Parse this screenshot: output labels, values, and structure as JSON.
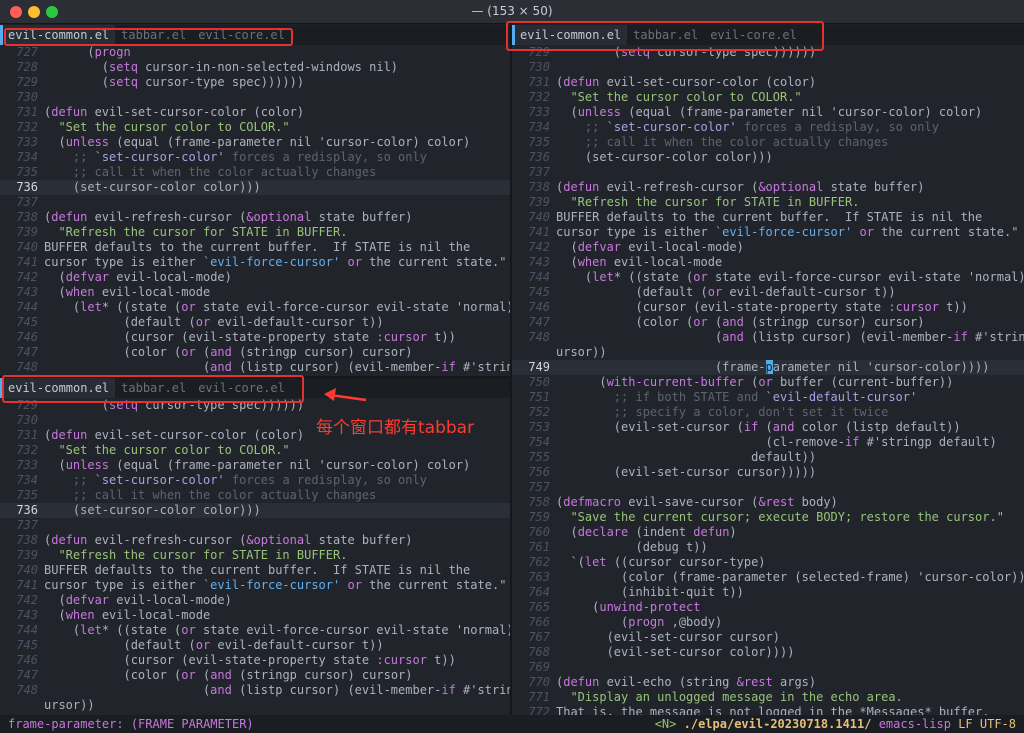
{
  "window": {
    "title": "— (153 × 50)",
    "buttons": [
      {
        "name": "close",
        "color": "#fe5f57"
      },
      {
        "name": "minimize",
        "color": "#febc2e"
      },
      {
        "name": "zoom",
        "color": "#28c840"
      }
    ]
  },
  "tabs": [
    "evil-common.el",
    "tabbar.el",
    "evil-core.el"
  ],
  "panes": {
    "top_left": {
      "lines": [
        {
          "n": "727",
          "c": "      (progn"
        },
        {
          "n": "728",
          "c": "        (setq cursor-in-non-selected-windows nil)"
        },
        {
          "n": "729",
          "c": "        (setq cursor-type spec))))))"
        },
        {
          "n": "730",
          "c": ""
        },
        {
          "n": "731",
          "c": "(defun evil-set-cursor-color (color)"
        },
        {
          "n": "732",
          "c": "  \"Set the cursor color to COLOR.\""
        },
        {
          "n": "733",
          "c": "  (unless (equal (frame-parameter nil 'cursor-color) color)"
        },
        {
          "n": "734",
          "c": "    ;; `set-cursor-color' forces a redisplay, so only"
        },
        {
          "n": "735",
          "c": "    ;; call it when the color actually changes"
        },
        {
          "n": "736",
          "c": "    (set-cursor-color color)))",
          "cur": true
        },
        {
          "n": "737",
          "c": ""
        },
        {
          "n": "738",
          "c": "(defun evil-refresh-cursor (&optional state buffer)"
        },
        {
          "n": "739",
          "c": "  \"Refresh the cursor for STATE in BUFFER."
        },
        {
          "n": "740",
          "c": "BUFFER defaults to the current buffer.  If STATE is nil the"
        },
        {
          "n": "741",
          "c": "cursor type is either `evil-force-cursor' or the current state.\""
        },
        {
          "n": "742",
          "c": "  (defvar evil-local-mode)"
        },
        {
          "n": "743",
          "c": "  (when evil-local-mode"
        },
        {
          "n": "744",
          "c": "    (let* ((state (or state evil-force-cursor evil-state 'normal))"
        },
        {
          "n": "745",
          "c": "           (default (or evil-default-cursor t))"
        },
        {
          "n": "746",
          "c": "           (cursor (evil-state-property state :cursor t))"
        },
        {
          "n": "747",
          "c": "           (color (or (and (stringp cursor) cursor)"
        },
        {
          "n": "748",
          "c": "                      (and (listp cursor) (evil-member-if #'stringp c"
        }
      ]
    },
    "bottom_left": {
      "lines": [
        {
          "n": "729",
          "c": "        (setq cursor-type spec))))))"
        },
        {
          "n": "730",
          "c": ""
        },
        {
          "n": "731",
          "c": "(defun evil-set-cursor-color (color)"
        },
        {
          "n": "732",
          "c": "  \"Set the cursor color to COLOR.\""
        },
        {
          "n": "733",
          "c": "  (unless (equal (frame-parameter nil 'cursor-color) color)"
        },
        {
          "n": "734",
          "c": "    ;; `set-cursor-color' forces a redisplay, so only"
        },
        {
          "n": "735",
          "c": "    ;; call it when the color actually changes"
        },
        {
          "n": "736",
          "c": "    (set-cursor-color color)))",
          "cur": true
        },
        {
          "n": "737",
          "c": ""
        },
        {
          "n": "738",
          "c": "(defun evil-refresh-cursor (&optional state buffer)"
        },
        {
          "n": "739",
          "c": "  \"Refresh the cursor for STATE in BUFFER."
        },
        {
          "n": "740",
          "c": "BUFFER defaults to the current buffer.  If STATE is nil the"
        },
        {
          "n": "741",
          "c": "cursor type is either `evil-force-cursor' or the current state.\""
        },
        {
          "n": "742",
          "c": "  (defvar evil-local-mode)"
        },
        {
          "n": "743",
          "c": "  (when evil-local-mode"
        },
        {
          "n": "744",
          "c": "    (let* ((state (or state evil-force-cursor evil-state 'normal))"
        },
        {
          "n": "745",
          "c": "           (default (or evil-default-cursor t))"
        },
        {
          "n": "746",
          "c": "           (cursor (evil-state-property state :cursor t))"
        },
        {
          "n": "747",
          "c": "           (color (or (and (stringp cursor) cursor)"
        },
        {
          "n": "748",
          "c": "                      (and (listp cursor) (evil-member-if #'stringp c"
        },
        {
          "n": "",
          "c": "ursor))"
        }
      ]
    },
    "right": {
      "lines": [
        {
          "n": "729",
          "c": "        (setq cursor-type spec))))))"
        },
        {
          "n": "730",
          "c": ""
        },
        {
          "n": "731",
          "c": "(defun evil-set-cursor-color (color)"
        },
        {
          "n": "732",
          "c": "  \"Set the cursor color to COLOR.\""
        },
        {
          "n": "733",
          "c": "  (unless (equal (frame-parameter nil 'cursor-color) color)"
        },
        {
          "n": "734",
          "c": "    ;; `set-cursor-color' forces a redisplay, so only"
        },
        {
          "n": "735",
          "c": "    ;; call it when the color actually changes"
        },
        {
          "n": "736",
          "c": "    (set-cursor-color color)))"
        },
        {
          "n": "737",
          "c": ""
        },
        {
          "n": "738",
          "c": "(defun evil-refresh-cursor (&optional state buffer)"
        },
        {
          "n": "739",
          "c": "  \"Refresh the cursor for STATE in BUFFER."
        },
        {
          "n": "740",
          "c": "BUFFER defaults to the current buffer.  If STATE is nil the"
        },
        {
          "n": "741",
          "c": "cursor type is either `evil-force-cursor' or the current state.\""
        },
        {
          "n": "742",
          "c": "  (defvar evil-local-mode)"
        },
        {
          "n": "743",
          "c": "  (when evil-local-mode"
        },
        {
          "n": "744",
          "c": "    (let* ((state (or state evil-force-cursor evil-state 'normal))"
        },
        {
          "n": "745",
          "c": "           (default (or evil-default-cursor t))"
        },
        {
          "n": "746",
          "c": "           (cursor (evil-state-property state :cursor t))"
        },
        {
          "n": "747",
          "c": "           (color (or (and (stringp cursor) cursor)"
        },
        {
          "n": "748",
          "c": "                      (and (listp cursor) (evil-member-if #'stringp c"
        },
        {
          "n": "",
          "c": "ursor))"
        },
        {
          "n": "749",
          "c": "                      (frame-parameter nil 'cursor-color))))",
          "cur": true
        },
        {
          "n": "750",
          "c": "      (with-current-buffer (or buffer (current-buffer))"
        },
        {
          "n": "751",
          "c": "        ;; if both STATE and `evil-default-cursor'"
        },
        {
          "n": "752",
          "c": "        ;; specify a color, don't set it twice"
        },
        {
          "n": "753",
          "c": "        (evil-set-cursor (if (and color (listp default))"
        },
        {
          "n": "754",
          "c": "                             (cl-remove-if #'stringp default)"
        },
        {
          "n": "755",
          "c": "                           default))"
        },
        {
          "n": "756",
          "c": "        (evil-set-cursor cursor)))))"
        },
        {
          "n": "757",
          "c": ""
        },
        {
          "n": "758",
          "c": "(defmacro evil-save-cursor (&rest body)"
        },
        {
          "n": "759",
          "c": "  \"Save the current cursor; execute BODY; restore the cursor.\""
        },
        {
          "n": "760",
          "c": "  (declare (indent defun)"
        },
        {
          "n": "761",
          "c": "           (debug t))"
        },
        {
          "n": "762",
          "c": "  `(let ((cursor cursor-type)"
        },
        {
          "n": "763",
          "c": "         (color (frame-parameter (selected-frame) 'cursor-color))"
        },
        {
          "n": "764",
          "c": "         (inhibit-quit t))"
        },
        {
          "n": "765",
          "c": "     (unwind-protect"
        },
        {
          "n": "766",
          "c": "         (progn ,@body)"
        },
        {
          "n": "767",
          "c": "       (evil-set-cursor cursor)"
        },
        {
          "n": "768",
          "c": "       (evil-set-cursor color))))"
        },
        {
          "n": "769",
          "c": ""
        },
        {
          "n": "770",
          "c": "(defun evil-echo (string &rest args)"
        },
        {
          "n": "771",
          "c": "  \"Display an unlogged message in the echo area."
        },
        {
          "n": "772",
          "c": "That is, the message is not logged in the *Messages* buffer."
        }
      ]
    }
  },
  "annotation": {
    "text": "每个窗口都有tabbar",
    "color": "#ff3a2f"
  },
  "modeline": {
    "echo": "frame-parameter: (FRAME PARAMETER)",
    "state": "<N>",
    "path": "./elpa/evil-20230718.1411/",
    "mode": "emacs-lisp",
    "eol": "LF",
    "encoding": "UTF-8"
  },
  "colors": {
    "accent": "#51afef",
    "highlight": "#e5322d",
    "background": "#21252b"
  }
}
